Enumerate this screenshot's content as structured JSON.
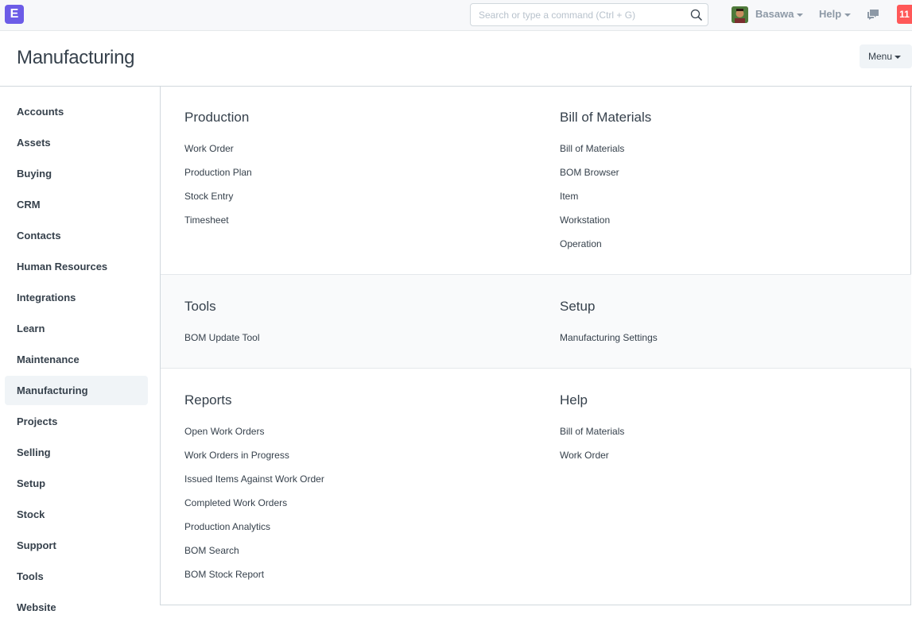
{
  "navbar": {
    "logo_letter": "E",
    "search_placeholder": "Search or type a command (Ctrl + G)",
    "user_name": "Basawa",
    "help_label": "Help",
    "notification_count": "11"
  },
  "page": {
    "title": "Manufacturing",
    "menu_label": "Menu"
  },
  "sidebar": {
    "items": [
      {
        "label": "Accounts"
      },
      {
        "label": "Assets"
      },
      {
        "label": "Buying"
      },
      {
        "label": "CRM"
      },
      {
        "label": "Contacts"
      },
      {
        "label": "Human Resources"
      },
      {
        "label": "Integrations"
      },
      {
        "label": "Learn"
      },
      {
        "label": "Maintenance"
      },
      {
        "label": "Manufacturing"
      },
      {
        "label": "Projects"
      },
      {
        "label": "Selling"
      },
      {
        "label": "Setup"
      },
      {
        "label": "Stock"
      },
      {
        "label": "Support"
      },
      {
        "label": "Tools"
      },
      {
        "label": "Website"
      }
    ],
    "active": "Manufacturing"
  },
  "sections": {
    "production": {
      "title": "Production",
      "links": [
        "Work Order",
        "Production Plan",
        "Stock Entry",
        "Timesheet"
      ]
    },
    "bom": {
      "title": "Bill of Materials",
      "links": [
        "Bill of Materials",
        "BOM Browser",
        "Item",
        "Workstation",
        "Operation"
      ]
    },
    "tools": {
      "title": "Tools",
      "links": [
        "BOM Update Tool"
      ]
    },
    "setup": {
      "title": "Setup",
      "links": [
        "Manufacturing Settings"
      ]
    },
    "reports": {
      "title": "Reports",
      "links": [
        "Open Work Orders",
        "Work Orders in Progress",
        "Issued Items Against Work Order",
        "Completed Work Orders",
        "Production Analytics",
        "BOM Search",
        "BOM Stock Report"
      ]
    },
    "help": {
      "title": "Help",
      "links": [
        "Bill of Materials",
        "Work Order"
      ]
    }
  },
  "colors": {
    "brand": "#6c5ce7",
    "notification": "#ff5858",
    "text": "#36414c",
    "muted": "#8d99a6"
  }
}
